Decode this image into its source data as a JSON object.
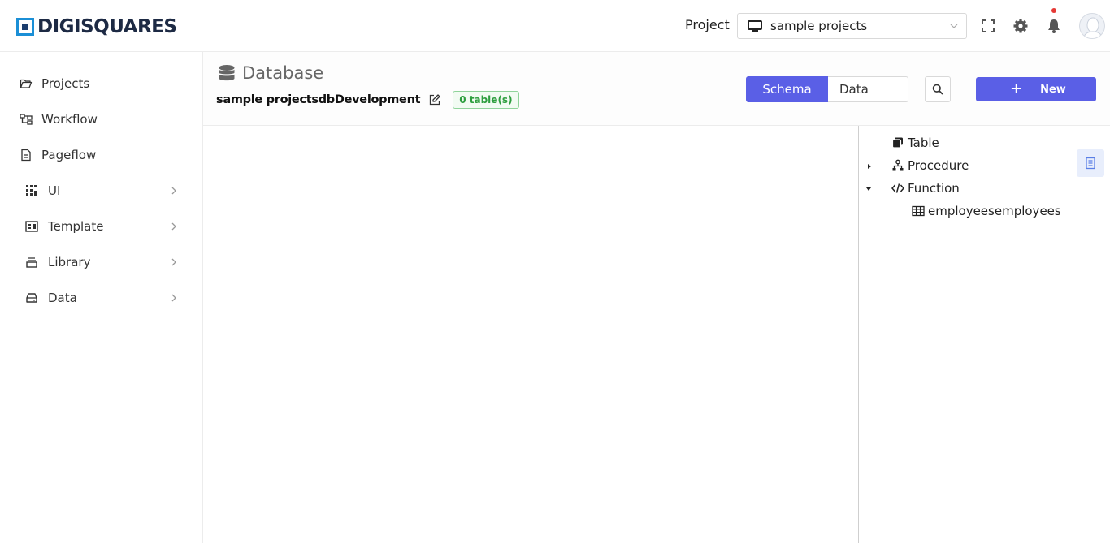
{
  "brand": {
    "name": "DIGISQUARES"
  },
  "header": {
    "project_label": "Project",
    "project_selected": "sample projects",
    "icons": [
      "fullscreen-icon",
      "gear-icon",
      "bell-icon",
      "avatar"
    ]
  },
  "sidebar": {
    "items": [
      {
        "label": "Projects",
        "icon": "folder-open-icon",
        "has_children": false
      },
      {
        "label": "Workflow",
        "icon": "workflow-icon",
        "has_children": false
      },
      {
        "label": "Pageflow",
        "icon": "page-icon",
        "has_children": false
      },
      {
        "label": "UI",
        "icon": "grid-icon",
        "has_children": true
      },
      {
        "label": "Template",
        "icon": "template-icon",
        "has_children": true
      },
      {
        "label": "Library",
        "icon": "library-icon",
        "has_children": true
      },
      {
        "label": "Data",
        "icon": "drive-icon",
        "has_children": true
      }
    ]
  },
  "main": {
    "title": "Database",
    "db_name": "sample projectsdbDevelopment",
    "table_count_badge": "0 table(s)",
    "tabs": {
      "schema": "Schema",
      "data": "Data",
      "active": "Schema"
    },
    "new_button": "New"
  },
  "tree": {
    "items": [
      {
        "label": "Table",
        "icon": "table-stack-icon",
        "expandable": false,
        "expanded": false
      },
      {
        "label": "Procedure",
        "icon": "sitemap-icon",
        "expandable": true,
        "expanded": false
      },
      {
        "label": "Function",
        "icon": "code-icon",
        "expandable": true,
        "expanded": true
      },
      {
        "label": "employeesemployees",
        "icon": "table-grid-icon",
        "child_of": "Function"
      }
    ]
  },
  "colors": {
    "accent": "#5a5fe6",
    "badge_green": "#2e9e3f",
    "notif_red": "#e53935",
    "logo_blue": "#1b8fd6"
  }
}
